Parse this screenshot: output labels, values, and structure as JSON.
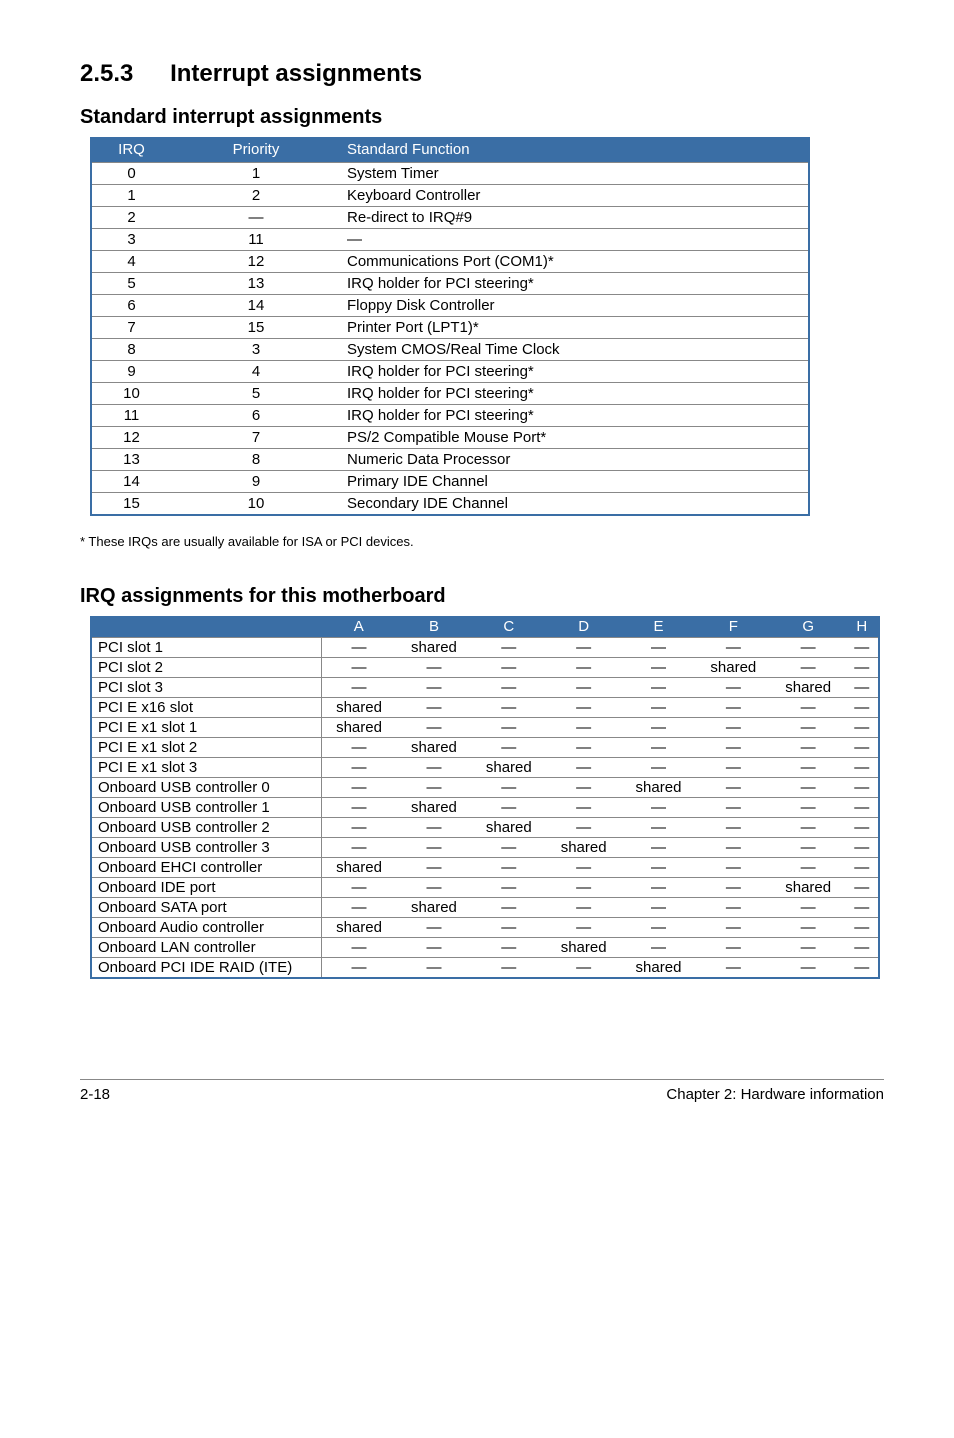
{
  "section": {
    "num": "2.5.3",
    "title": "Interrupt assignments"
  },
  "sub1": "Standard interrupt assignments",
  "irq_table": {
    "headers": {
      "irq": "IRQ",
      "priority": "Priority",
      "func": "Standard Function"
    },
    "rows": [
      {
        "irq": "0",
        "priority": "1",
        "func": "System Timer"
      },
      {
        "irq": "1",
        "priority": "2",
        "func": "Keyboard Controller"
      },
      {
        "irq": "2",
        "priority": "—",
        "func": "Re-direct to IRQ#9"
      },
      {
        "irq": "3",
        "priority": "11",
        "func": "—"
      },
      {
        "irq": "4",
        "priority": "12",
        "func": "Communications Port (COM1)*"
      },
      {
        "irq": "5",
        "priority": "13",
        "func": "IRQ holder for PCI steering*"
      },
      {
        "irq": "6",
        "priority": "14",
        "func": "Floppy Disk Controller"
      },
      {
        "irq": "7",
        "priority": "15",
        "func": "Printer Port (LPT1)*"
      },
      {
        "irq": "8",
        "priority": "3",
        "func": "System CMOS/Real Time Clock"
      },
      {
        "irq": "9",
        "priority": "4",
        "func": "IRQ holder for PCI steering*"
      },
      {
        "irq": "10",
        "priority": "5",
        "func": "IRQ holder for PCI steering*"
      },
      {
        "irq": "11",
        "priority": "6",
        "func": "IRQ holder for PCI steering*"
      },
      {
        "irq": "12",
        "priority": "7",
        "func": "PS/2 Compatible Mouse Port*"
      },
      {
        "irq": "13",
        "priority": "8",
        "func": "Numeric Data Processor"
      },
      {
        "irq": "14",
        "priority": "9",
        "func": "Primary IDE Channel"
      },
      {
        "irq": "15",
        "priority": "10",
        "func": "Secondary IDE Channel"
      }
    ]
  },
  "footnote": "* These IRQs are usually available for ISA or PCI devices.",
  "sub2": "IRQ assignments for this motherboard",
  "board_table": {
    "cols": [
      "A",
      "B",
      "C",
      "D",
      "E",
      "F",
      "G",
      "H"
    ],
    "rows": [
      {
        "label": "PCI slot 1",
        "cells": [
          "—",
          "shared",
          "—",
          "—",
          "—",
          "—",
          "—",
          "—"
        ]
      },
      {
        "label": "PCI slot 2",
        "cells": [
          "—",
          "—",
          "—",
          "—",
          "—",
          "shared",
          "—",
          "—"
        ]
      },
      {
        "label": "PCI slot 3",
        "cells": [
          "—",
          "—",
          "—",
          "—",
          "—",
          "—",
          "shared",
          "—"
        ]
      },
      {
        "label": "PCI E x16 slot",
        "cells": [
          "shared",
          "—",
          "—",
          "—",
          "—",
          "—",
          "—",
          "—"
        ]
      },
      {
        "label": "PCI E x1 slot 1",
        "cells": [
          "shared",
          "—",
          "—",
          "—",
          "—",
          "—",
          "—",
          "—"
        ]
      },
      {
        "label": "PCI E x1 slot 2",
        "cells": [
          "—",
          "shared",
          "—",
          "—",
          "—",
          "—",
          "—",
          "—"
        ]
      },
      {
        "label": "PCI E x1 slot 3",
        "cells": [
          "—",
          "—",
          "shared",
          "—",
          "—",
          "—",
          "—",
          "—"
        ]
      },
      {
        "label": "Onboard USB controller 0",
        "cells": [
          "—",
          "—",
          "—",
          "—",
          "shared",
          "—",
          "—",
          "—"
        ]
      },
      {
        "label": "Onboard USB controller 1",
        "cells": [
          "—",
          "shared",
          "—",
          "—",
          "—",
          "—",
          "—",
          "—"
        ]
      },
      {
        "label": "Onboard USB controller 2",
        "cells": [
          "—",
          "—",
          "shared",
          "—",
          "—",
          "—",
          "—",
          "—"
        ]
      },
      {
        "label": "Onboard USB controller 3",
        "cells": [
          "—",
          "—",
          "—",
          "shared",
          "—",
          "—",
          "—",
          "—"
        ]
      },
      {
        "label": "Onboard EHCI controller",
        "cells": [
          "shared",
          "—",
          "—",
          "—",
          "—",
          "—",
          "—",
          "—"
        ]
      },
      {
        "label": "Onboard IDE port",
        "cells": [
          "—",
          "—",
          "—",
          "—",
          "—",
          "—",
          "shared",
          "—"
        ]
      },
      {
        "label": "Onboard SATA port",
        "cells": [
          "—",
          "shared",
          "—",
          "—",
          "—",
          "—",
          "—",
          "—"
        ]
      },
      {
        "label": "Onboard Audio controller",
        "cells": [
          "shared",
          "—",
          "—",
          "—",
          "—",
          "—",
          "—",
          "—"
        ]
      },
      {
        "label": "Onboard LAN controller",
        "cells": [
          "—",
          "—",
          "—",
          "shared",
          "—",
          "—",
          "—",
          "—"
        ]
      },
      {
        "label": "Onboard PCI IDE RAID (ITE)",
        "cells": [
          "—",
          "—",
          "—",
          "—",
          "shared",
          "—",
          "—",
          "—"
        ]
      }
    ]
  },
  "footer": {
    "page": "2-18",
    "chapter": "Chapter 2: Hardware information"
  }
}
